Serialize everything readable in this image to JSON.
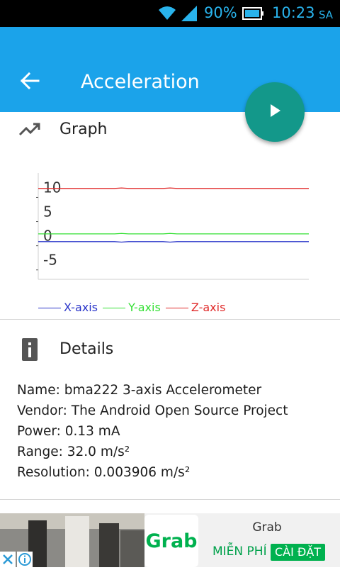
{
  "status_bar": {
    "battery_percent": "90%",
    "time": "10:23",
    "ampm": "SA"
  },
  "app_bar": {
    "title": "Acceleration"
  },
  "graph_section": {
    "heading": "Graph",
    "icon": "trending-up-icon"
  },
  "details_section": {
    "heading": "Details",
    "icon": "info-icon",
    "lines": [
      "Name: bma222 3-axis Accelerometer",
      "Vendor: The Android Open Source Project",
      "Power: 0.13 mA",
      "Range: 32.0 m/s²",
      "Resolution: 0.003906 m/s²"
    ]
  },
  "colors": {
    "status_bar": "#000000",
    "status_icons": "#29b3ec",
    "app_bar": "#1ba3ea",
    "fab": "#13988a",
    "x_axis": "#2a35c9",
    "y_axis": "#35e035",
    "z_axis": "#e02a2a"
  },
  "chart_data": {
    "type": "line",
    "tick_labels": [
      "10",
      "5",
      "0",
      "-5"
    ],
    "ylim": [
      -9,
      13
    ],
    "legend_position": "bottom-left",
    "x": [
      0,
      1,
      2,
      3,
      4,
      5,
      6,
      7,
      8,
      9,
      10,
      11,
      12,
      13,
      14,
      15,
      16,
      17,
      18,
      19,
      20,
      21,
      22,
      23,
      24,
      25,
      26,
      27,
      28,
      29,
      30,
      31,
      32,
      33,
      34,
      35,
      36,
      37,
      38,
      39
    ],
    "series": [
      {
        "name": "X-axis",
        "color": "#2a35c9",
        "values": [
          -1.2,
          -1.2,
          -1.2,
          -1.2,
          -1.2,
          -1.2,
          -1.2,
          -1.2,
          -1.2,
          -1.2,
          -1.2,
          -1.2,
          -1.3,
          -1.2,
          -1.2,
          -1.2,
          -1.2,
          -1.2,
          -1.2,
          -1.3,
          -1.2,
          -1.2,
          -1.2,
          -1.2,
          -1.2,
          -1.2,
          -1.2,
          -1.2,
          -1.2,
          -1.2,
          -1.2,
          -1.2,
          -1.2,
          -1.2,
          -1.2,
          -1.2,
          -1.2,
          -1.2,
          -1.2,
          -1.2
        ]
      },
      {
        "name": "Y-axis",
        "color": "#35e035",
        "values": [
          0.4,
          0.4,
          0.4,
          0.4,
          0.4,
          0.4,
          0.4,
          0.4,
          0.4,
          0.4,
          0.4,
          0.4,
          0.5,
          0.4,
          0.4,
          0.4,
          0.4,
          0.4,
          0.4,
          0.5,
          0.4,
          0.4,
          0.4,
          0.4,
          0.4,
          0.4,
          0.4,
          0.4,
          0.4,
          0.4,
          0.4,
          0.4,
          0.4,
          0.4,
          0.4,
          0.4,
          0.4,
          0.4,
          0.4,
          0.4
        ]
      },
      {
        "name": "Z-axis",
        "color": "#e02a2a",
        "values": [
          9.8,
          9.8,
          9.8,
          9.8,
          9.8,
          9.8,
          9.8,
          9.8,
          9.8,
          9.8,
          9.8,
          9.8,
          9.9,
          9.8,
          9.8,
          9.8,
          9.8,
          9.8,
          9.8,
          9.9,
          9.8,
          9.8,
          9.8,
          9.8,
          9.8,
          9.8,
          9.8,
          9.8,
          9.8,
          9.8,
          9.8,
          9.8,
          9.8,
          9.8,
          9.8,
          9.8,
          9.8,
          9.8,
          9.8,
          9.8
        ]
      }
    ]
  },
  "ad": {
    "logo_text": "Grab",
    "app_name": "Grab",
    "free_label": "MIỄN PHÍ",
    "install_label": "CÀI ĐẶT"
  }
}
